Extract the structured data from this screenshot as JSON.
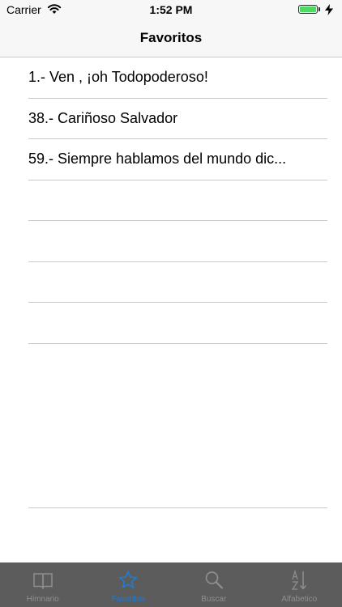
{
  "status_bar": {
    "carrier": "Carrier",
    "time": "1:52 PM",
    "battery_level": 1.0,
    "charging": true
  },
  "nav": {
    "title": "Favoritos"
  },
  "favorites": [
    "1.- Ven , ¡oh Todopoderoso!",
    "38.- Cariñoso Salvador",
    "59.- Siempre hablamos del mundo dic..."
  ],
  "tabs": [
    {
      "label": "Himnario",
      "icon": "book-icon",
      "active": false
    },
    {
      "label": "Favoritos",
      "icon": "star-icon",
      "active": true
    },
    {
      "label": "Buscar",
      "icon": "search-icon",
      "active": false
    },
    {
      "label": "Alfabetico",
      "icon": "alphabetical-sort-icon",
      "active": false
    }
  ],
  "colors": {
    "accent": "#1e7bd6",
    "tab_bar_bg": "#5c5c5c",
    "inactive_tab": "#8e8e93",
    "battery": "#4cd964",
    "separator": "#c8c7cc"
  }
}
